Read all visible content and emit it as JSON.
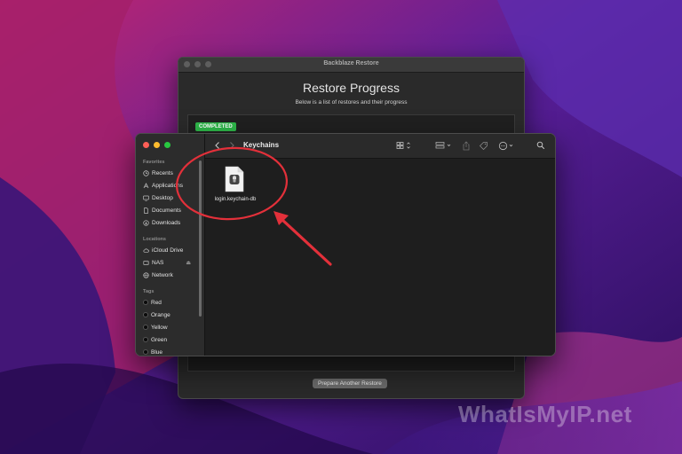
{
  "colors": {
    "accent_annotation": "#e3303a",
    "badge_green": "#2eb84a",
    "wallpaper_deep": "#2a0e5c",
    "wallpaper_pink": "#c2266f"
  },
  "backblaze": {
    "window_title": "Backblaze Restore",
    "heading": "Restore Progress",
    "subtitle": "Below is a list of restores and their progress",
    "status_badge": "COMPLETED",
    "action_button": "Prepare Another Restore"
  },
  "finder": {
    "folder_title": "Keychains",
    "toolbar_icons": [
      "chevron-left-icon",
      "chevron-right-icon",
      "icon-view-icon",
      "group-by-icon",
      "share-icon",
      "tag-icon",
      "more-actions-icon",
      "search-icon"
    ],
    "sidebar": {
      "favorites_label": "Favorites",
      "favorites": [
        {
          "label": "Recents",
          "icon": "clock-icon"
        },
        {
          "label": "Applications",
          "icon": "applications-icon"
        },
        {
          "label": "Desktop",
          "icon": "desktop-icon"
        },
        {
          "label": "Documents",
          "icon": "document-icon"
        },
        {
          "label": "Downloads",
          "icon": "download-icon"
        }
      ],
      "locations_label": "Locations",
      "locations": [
        {
          "label": "iCloud Drive",
          "icon": "cloud-icon"
        },
        {
          "label": "NAS",
          "icon": "server-icon"
        },
        {
          "label": "Network",
          "icon": "network-icon"
        }
      ],
      "tags_label": "Tags",
      "tags": [
        "Red",
        "Orange",
        "Yellow",
        "Green",
        "Blue"
      ]
    },
    "files": [
      {
        "name": "login.keychain-db",
        "icon": "keychain-file-icon"
      }
    ]
  },
  "watermark": "WhatIsMyIP.net"
}
